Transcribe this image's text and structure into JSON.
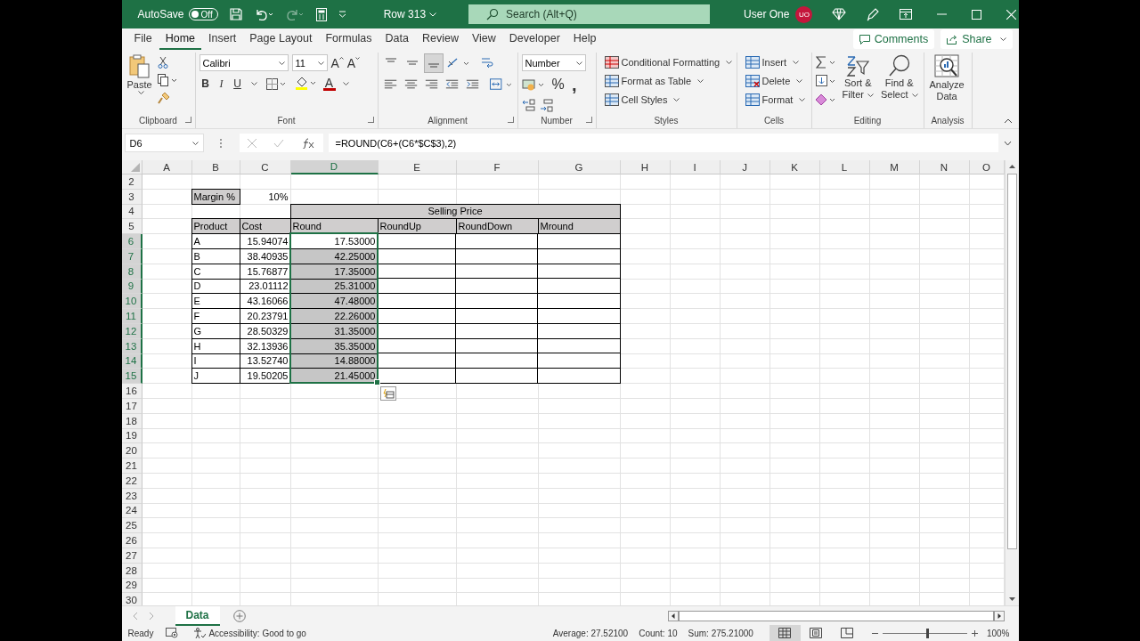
{
  "title_bar": {
    "autosave_label": "AutoSave",
    "autosave": {
      "on": false,
      "label": "Off"
    },
    "document": "Row 313",
    "search": {
      "placeholder": "Search (Alt+Q)"
    },
    "user": {
      "name": "User One",
      "initials": "UO"
    }
  },
  "menu_tabs": [
    {
      "label": "File",
      "selected": false
    },
    {
      "label": "Home",
      "selected": true
    },
    {
      "label": "Insert",
      "selected": false
    },
    {
      "label": "Page Layout",
      "selected": false
    },
    {
      "label": "Formulas",
      "selected": false
    },
    {
      "label": "Data",
      "selected": false
    },
    {
      "label": "Review",
      "selected": false
    },
    {
      "label": "View",
      "selected": false
    },
    {
      "label": "Developer",
      "selected": false
    },
    {
      "label": "Help",
      "selected": false
    }
  ],
  "comments": "Comments",
  "share": "Share",
  "ribbon": {
    "clipboard": {
      "paste": "Paste",
      "label": "Clipboard"
    },
    "font": {
      "family": "Calibri",
      "size": "11",
      "grow": "A",
      "shrink": "A",
      "bold": "B",
      "italic": "I",
      "underline": "U",
      "color_letter": "A",
      "label": "Font"
    },
    "alignment": {
      "label": "Alignment"
    },
    "number": {
      "format": "Number",
      "percent": "%",
      "comma": ",",
      "label": "Number"
    },
    "styles": {
      "items": [
        "Conditional Formatting",
        "Format as Table",
        "Cell Styles"
      ],
      "label": "Styles"
    },
    "cells": {
      "items": [
        "Insert",
        "Delete",
        "Format"
      ],
      "label": "Cells"
    },
    "editing": {
      "sort": [
        "Sort &",
        "Filter"
      ],
      "find": [
        "Find &",
        "Select"
      ],
      "label": "Editing"
    },
    "analysis": {
      "button": [
        "Analyze",
        "Data"
      ],
      "label": "Analysis"
    }
  },
  "formula_bar": {
    "name_box": "D6",
    "formula": "=ROUND(C6+(C6*$C$3),2)"
  },
  "columns": [
    {
      "label": "A",
      "selected": false
    },
    {
      "label": "B",
      "selected": false
    },
    {
      "label": "C",
      "selected": false
    },
    {
      "label": "D",
      "selected": true
    },
    {
      "label": "E",
      "selected": false
    },
    {
      "label": "F",
      "selected": false
    },
    {
      "label": "G",
      "selected": false
    },
    {
      "label": "H",
      "selected": false
    },
    {
      "label": "I",
      "selected": false
    },
    {
      "label": "J",
      "selected": false
    },
    {
      "label": "K",
      "selected": false
    },
    {
      "label": "L",
      "selected": false
    },
    {
      "label": "M",
      "selected": false
    },
    {
      "label": "N",
      "selected": false
    },
    {
      "label": "O",
      "selected": false
    }
  ],
  "rows": [
    {
      "label": "2",
      "selected": false
    },
    {
      "label": "3",
      "selected": false
    },
    {
      "label": "4",
      "selected": false
    },
    {
      "label": "5",
      "selected": false
    },
    {
      "label": "6",
      "selected": true
    },
    {
      "label": "7",
      "selected": true
    },
    {
      "label": "8",
      "selected": true
    },
    {
      "label": "9",
      "selected": true
    },
    {
      "label": "10",
      "selected": true
    },
    {
      "label": "11",
      "selected": true
    },
    {
      "label": "12",
      "selected": true
    },
    {
      "label": "13",
      "selected": true
    },
    {
      "label": "14",
      "selected": true
    },
    {
      "label": "15",
      "selected": true
    },
    {
      "label": "16",
      "selected": false
    },
    {
      "label": "17",
      "selected": false
    },
    {
      "label": "18",
      "selected": false
    },
    {
      "label": "19",
      "selected": false
    },
    {
      "label": "20",
      "selected": false
    },
    {
      "label": "21",
      "selected": false
    },
    {
      "label": "22",
      "selected": false
    },
    {
      "label": "23",
      "selected": false
    },
    {
      "label": "24",
      "selected": false
    },
    {
      "label": "25",
      "selected": false
    },
    {
      "label": "26",
      "selected": false
    },
    {
      "label": "27",
      "selected": false
    },
    {
      "label": "28",
      "selected": false
    },
    {
      "label": "29",
      "selected": false
    },
    {
      "label": "30",
      "selected": false
    }
  ],
  "margin": {
    "label": "Margin %",
    "value": "10%"
  },
  "table": {
    "group_header": "Selling Price",
    "headers": [
      "Product",
      "Cost",
      "Round",
      "RoundUp",
      "RoundDown",
      "Mround"
    ],
    "rows": [
      {
        "product": "A",
        "cost": "15.94074",
        "round": "17.53000",
        "selected": true,
        "active": true
      },
      {
        "product": "B",
        "cost": "38.40935",
        "round": "42.25000",
        "selected": true,
        "active": false
      },
      {
        "product": "C",
        "cost": "15.76877",
        "round": "17.35000",
        "selected": true,
        "active": false
      },
      {
        "product": "D",
        "cost": "23.01112",
        "round": "25.31000",
        "selected": true,
        "active": false
      },
      {
        "product": "E",
        "cost": "43.16066",
        "round": "47.48000",
        "selected": true,
        "active": false
      },
      {
        "product": "F",
        "cost": "20.23791",
        "round": "22.26000",
        "selected": true,
        "active": false
      },
      {
        "product": "G",
        "cost": "28.50329",
        "round": "31.35000",
        "selected": true,
        "active": false
      },
      {
        "product": "H",
        "cost": "32.13936",
        "round": "35.35000",
        "selected": true,
        "active": false
      },
      {
        "product": "I",
        "cost": "13.52740",
        "round": "14.88000",
        "selected": true,
        "active": false
      },
      {
        "product": "J",
        "cost": "19.50205",
        "round": "21.45000",
        "selected": true,
        "active": false
      }
    ]
  },
  "sheet_tabs": [
    {
      "label": "Data",
      "selected": true
    }
  ],
  "status_bar": {
    "mode": "Ready",
    "accessibility": "Accessibility: Good to go",
    "average": "Average: 27.52100",
    "count": "Count: 10",
    "sum": "Sum: 275.21000",
    "views": [
      {
        "kind": "normal",
        "selected": true
      },
      {
        "kind": "page_layout",
        "selected": false
      },
      {
        "kind": "page_break",
        "selected": false
      }
    ],
    "zoom": {
      "level": 0.53,
      "reading": "100%"
    }
  }
}
